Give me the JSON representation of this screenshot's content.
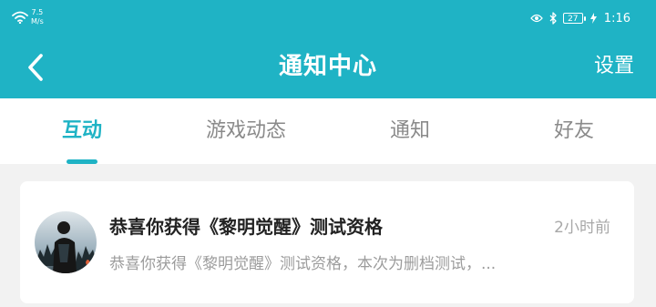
{
  "status_bar": {
    "speed_value": "7.5",
    "speed_unit": "M/s",
    "battery": "27",
    "time": "1:16",
    "icons": [
      "wifi-icon",
      "eye-icon",
      "bluetooth-icon",
      "battery-icon",
      "charging-icon"
    ]
  },
  "header": {
    "title": "通知中心",
    "settings_label": "设置",
    "back_icon": "chevron-left-icon"
  },
  "tabs": [
    {
      "label": "互动",
      "active": true
    },
    {
      "label": "游戏动态",
      "active": false
    },
    {
      "label": "通知",
      "active": false
    },
    {
      "label": "好友",
      "active": false
    }
  ],
  "notifications": [
    {
      "title": "恭喜你获得《黎明觉醒》测试资格",
      "time": "2小时前",
      "preview": "恭喜你获得《黎明觉醒》测试资格，本次为删档测试，..."
    }
  ],
  "colors": {
    "accent": "#1fb3c5",
    "background": "#f2f2f2",
    "card": "#ffffff"
  }
}
